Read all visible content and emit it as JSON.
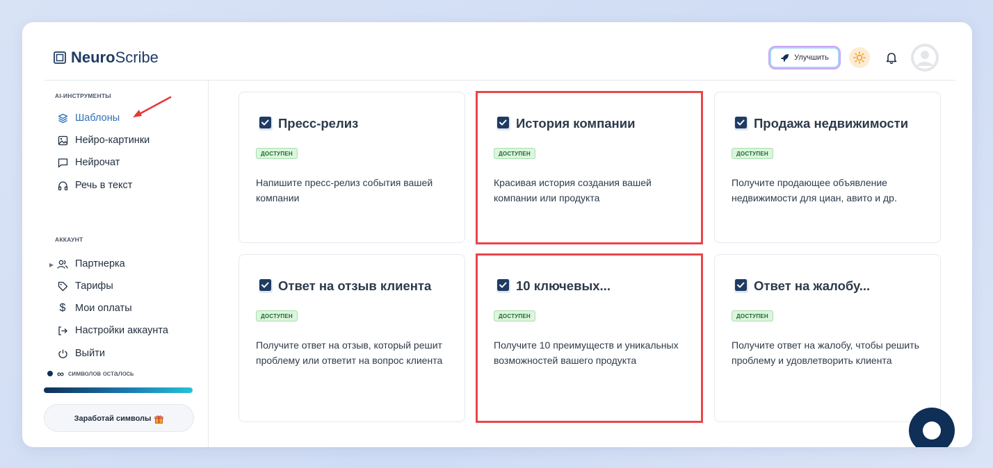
{
  "header": {
    "logo_bold": "Neuro",
    "logo_light": "Scribe",
    "upgrade_label": "Улучшить"
  },
  "sidebar": {
    "ai_tools_title": "AI-ИНСТРУМЕНТЫ",
    "ai_items": [
      {
        "label": "Шаблоны",
        "icon": "layers-icon",
        "active": true
      },
      {
        "label": "Нейро-картинки",
        "icon": "image-icon"
      },
      {
        "label": "Нейрочат",
        "icon": "chat-icon"
      },
      {
        "label": "Речь в текст",
        "icon": "headphones-icon"
      }
    ],
    "account_title": "АККАУНТ",
    "account_items": [
      {
        "label": "Партнерка",
        "icon": "users-icon"
      },
      {
        "label": "Тарифы",
        "icon": "tag-icon"
      },
      {
        "label": "Мои оплаты",
        "icon": "dollar-icon"
      },
      {
        "label": "Настройки аккаунта",
        "icon": "login-icon"
      },
      {
        "label": "Выйти",
        "icon": "power-icon"
      }
    ],
    "symbols_value": "∞",
    "symbols_label": "символов осталось",
    "symbols_progress": 1.0,
    "earn_label": "Заработай символы"
  },
  "cards": [
    {
      "title": "Пресс-релиз",
      "badge": "ДОСТУПЕН",
      "desc": "Напишите пресс-релиз события вашей компании"
    },
    {
      "title": "История компании",
      "badge": "ДОСТУПЕН",
      "desc": "Красивая история создания вашей компании или продукта"
    },
    {
      "title": "Продажа недвижимости",
      "badge": "ДОСТУПЕН",
      "desc": "Получите продающее объявление недвижимости для циан, авито и др."
    },
    {
      "title": "Ответ на отзыв клиента",
      "badge": "ДОСТУПЕН",
      "desc": "Получите ответ на отзыв, который решит проблему или ответит на вопрос клиента"
    },
    {
      "title": "10 ключевых...",
      "badge": "ДОСТУПЕН",
      "desc": "Получите 10 преимуществ и уникальных возможностей вашего продукта"
    },
    {
      "title": "Ответ на жалобу...",
      "badge": "ДОСТУПЕН",
      "desc": "Получите ответ на жалобу, чтобы решить проблему и удовлетворить клиента"
    }
  ],
  "colors": {
    "accent": "#2f6fb6",
    "brand_dark": "#0f2f57",
    "highlight": "#e8464a",
    "badge_bg": "#dcf5de"
  }
}
